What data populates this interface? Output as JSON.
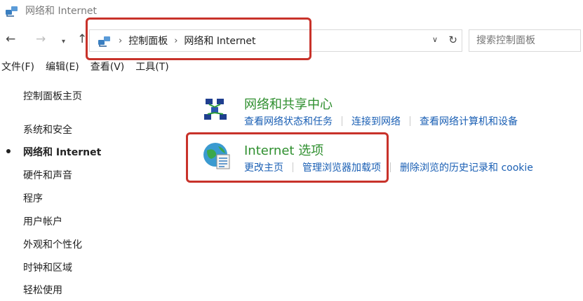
{
  "window": {
    "title": "网络和 Internet",
    "icon": "network-icon"
  },
  "nav": {
    "back_icon": "←",
    "forward_icon": "→",
    "recent_icon": "▾",
    "up_icon": "↑"
  },
  "address": {
    "crumbs": [
      "控制面板",
      "网络和 Internet"
    ],
    "separator": "›",
    "dropdown_icon": "∨",
    "refresh_icon": "↻"
  },
  "search": {
    "placeholder": "搜索控制面板"
  },
  "menu": [
    "文件(F)",
    "编辑(E)",
    "查看(V)",
    "工具(T)"
  ],
  "sidebar": {
    "home": "控制面板主页",
    "items": [
      {
        "label": "系统和安全",
        "active": false
      },
      {
        "label": "网络和 Internet",
        "active": true
      },
      {
        "label": "硬件和声音",
        "active": false
      },
      {
        "label": "程序",
        "active": false
      },
      {
        "label": "用户帐户",
        "active": false
      },
      {
        "label": "外观和个性化",
        "active": false
      },
      {
        "label": "时钟和区域",
        "active": false
      },
      {
        "label": "轻松使用",
        "active": false
      }
    ]
  },
  "sections": [
    {
      "icon": "network-sharing-center-icon",
      "heading": "网络和共享中心",
      "links": [
        "查看网络状态和任务",
        "连接到网络",
        "查看网络计算机和设备"
      ]
    },
    {
      "icon": "internet-options-icon",
      "heading": "Internet 选项",
      "links": [
        "更改主页",
        "管理浏览器加载项",
        "删除浏览的历史记录和 cookie"
      ]
    }
  ],
  "colors": {
    "highlight": "#c8322a",
    "heading_green": "#2f8f2f",
    "link_blue": "#1a5fb4"
  }
}
